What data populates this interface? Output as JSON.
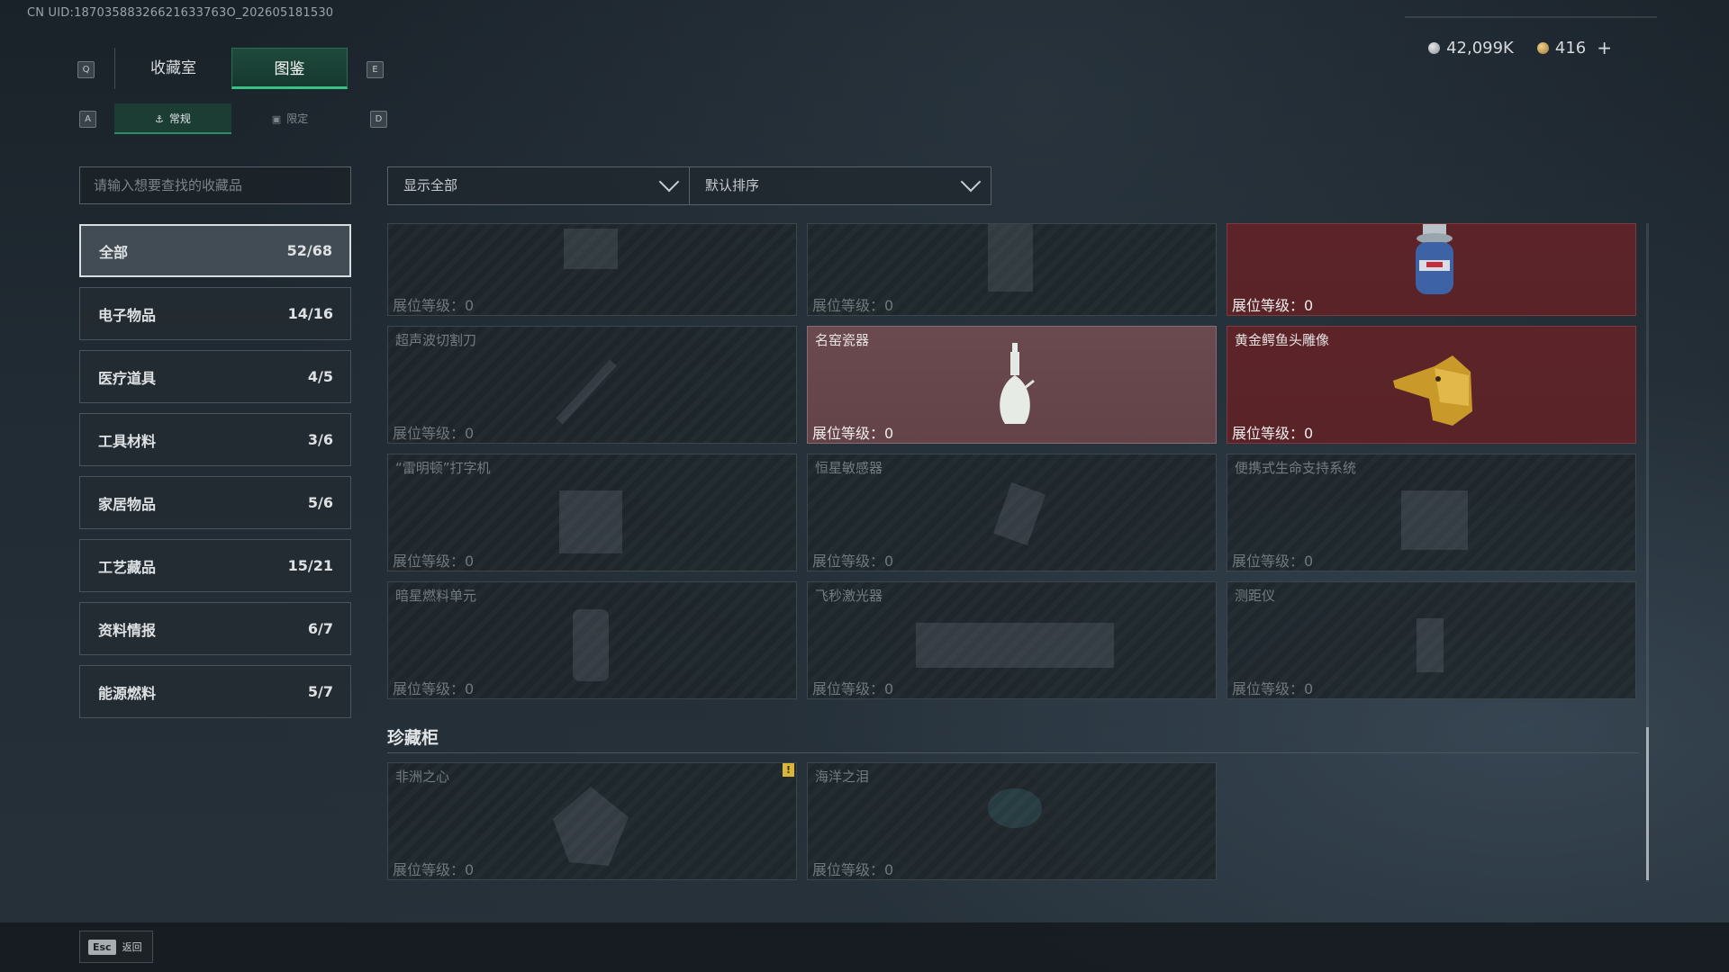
{
  "uid_text": "CN UID:18703588326621633763О_202605181530",
  "nav": {
    "key_prev": "Q",
    "key_next": "E",
    "tabs": [
      {
        "label": "收藏室",
        "active": false
      },
      {
        "label": "图鉴",
        "active": true
      }
    ],
    "sub_key_prev": "A",
    "sub_key_next": "D",
    "subtabs": [
      {
        "label": "常规",
        "icon": "bottle-icon",
        "active": true
      },
      {
        "label": "限定",
        "icon": "image-icon",
        "active": false
      }
    ]
  },
  "currency": {
    "silver_value": "42,099K",
    "gold_value": "416",
    "plus": "+"
  },
  "search": {
    "placeholder": "请输入想要查找的收藏品"
  },
  "filters": {
    "show": "显示全部",
    "sort": "默认排序"
  },
  "categories": [
    {
      "label": "全部",
      "count": "52/68",
      "active": true
    },
    {
      "label": "电子物品",
      "count": "14/16"
    },
    {
      "label": "医疗道具",
      "count": "4/5"
    },
    {
      "label": "工具材料",
      "count": "3/6"
    },
    {
      "label": "家居物品",
      "count": "5/6"
    },
    {
      "label": "工艺藏品",
      "count": "15/21"
    },
    {
      "label": "资料情报",
      "count": "6/7"
    },
    {
      "label": "能源燃料",
      "count": "5/7"
    }
  ],
  "items": [
    {
      "name": "",
      "level": "展位等级：0",
      "state": "locked"
    },
    {
      "name": "",
      "level": "展位等级：0",
      "state": "locked"
    },
    {
      "name": "",
      "level": "展位等级：0",
      "state": "owned-red",
      "icon": "gas-canister-icon"
    },
    {
      "name": "超声波切割刀",
      "level": "展位等级：0",
      "state": "locked"
    },
    {
      "name": "名窑瓷器",
      "level": "展位等级：0",
      "state": "owned-pink",
      "icon": "porcelain-vase-icon"
    },
    {
      "name": "黄金鳄鱼头雕像",
      "level": "展位等级：0",
      "state": "owned-red",
      "icon": "golden-crocodile-icon"
    },
    {
      "name": "“雷明顿”打字机",
      "level": "展位等级：0",
      "state": "locked"
    },
    {
      "name": "恒星敏感器",
      "level": "展位等级：0",
      "state": "locked"
    },
    {
      "name": "便携式生命支持系统",
      "level": "展位等级：0",
      "state": "locked"
    },
    {
      "name": "暗星燃料单元",
      "level": "展位等级：0",
      "state": "locked"
    },
    {
      "name": "飞秒激光器",
      "level": "展位等级：0",
      "state": "locked"
    },
    {
      "name": "测距仪",
      "level": "展位等级：0",
      "state": "locked"
    }
  ],
  "treasure": {
    "title": "珍藏柜",
    "items": [
      {
        "name": "非洲之心",
        "level": "展位等级：0",
        "flag": "!"
      },
      {
        "name": "海洋之泪",
        "level": "展位等级：0"
      }
    ]
  },
  "footer": {
    "esc_key": "Esc",
    "back_label": "返回"
  }
}
